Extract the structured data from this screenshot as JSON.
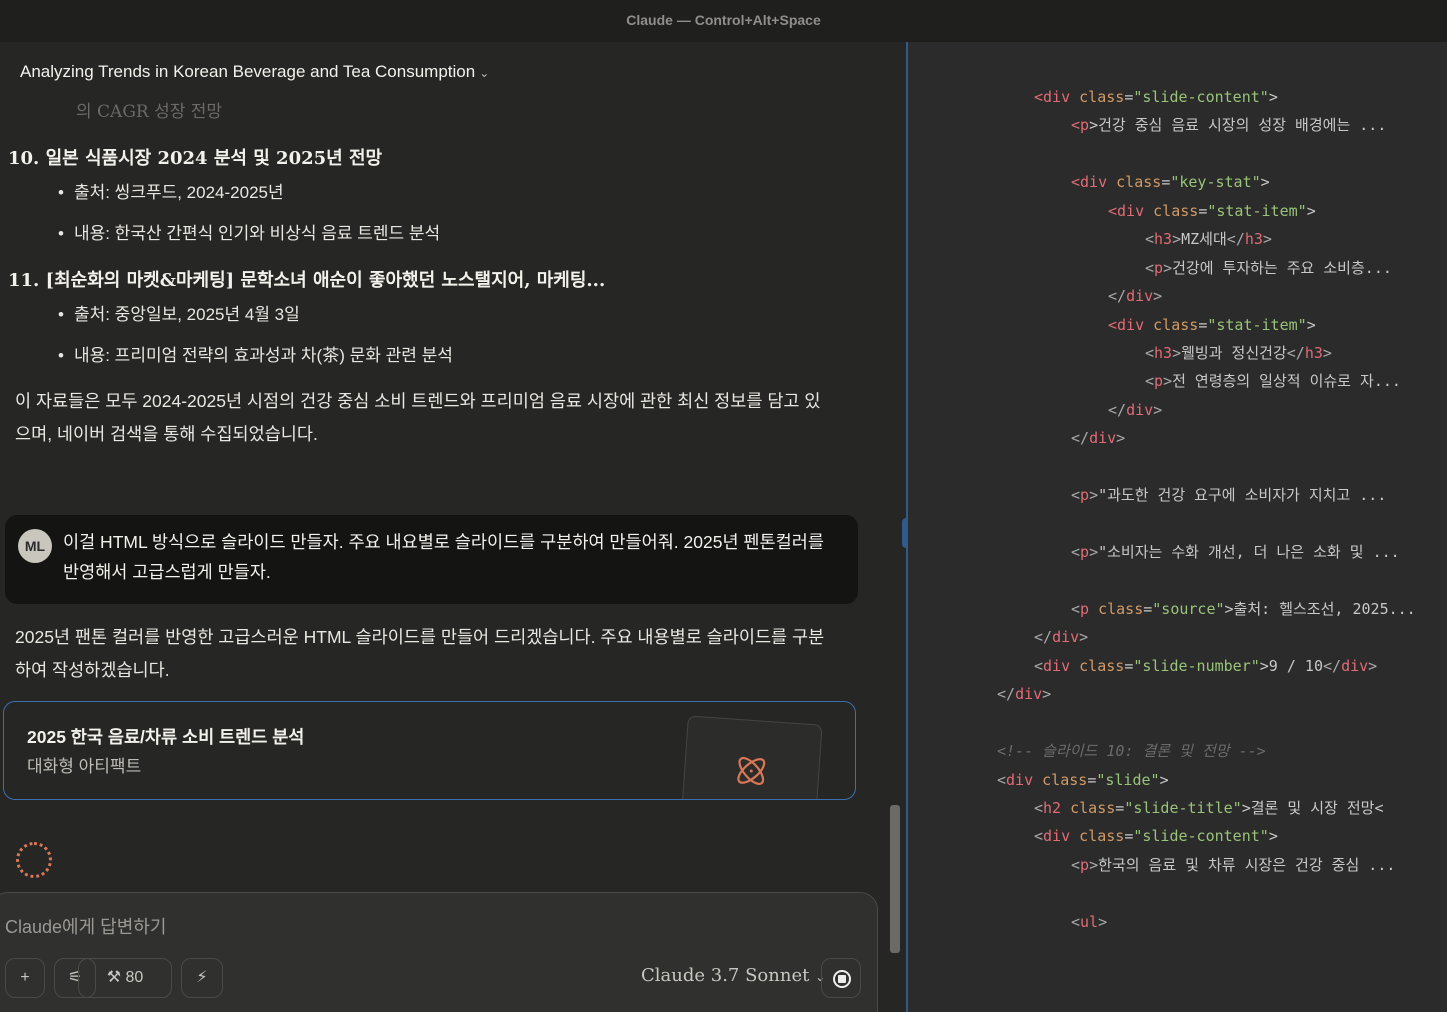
{
  "window": {
    "title": "Claude — Control+Alt+Space"
  },
  "conversation": {
    "title": "Analyzing Trends in Korean Beverage and Tea Consumption",
    "faded_line": "의 CAGR 성장 전망",
    "items": [
      {
        "heading": "10. 일본 식품시장 2024 분석 및 2025년 전망",
        "source": "출처: 씽크푸드, 2024-2025년",
        "content": "내용: 한국산 간편식 인기와 비상식 음료 트렌드 분석"
      },
      {
        "heading": "11. [최순화의 마켓&마케팅] 문학소녀 애순이 좋아했던 노스탤지어, 마케팅...",
        "source": "출처: 중앙일보, 2025년 4월 3일",
        "content": "내용: 프리미엄 전략의 효과성과 차(茶) 문화 관련 분석"
      }
    ],
    "summary": "이 자료들은 모두 2024-2025년 시점의 건강 중심 소비 트렌드와 프리미엄 음료 시장에 관한 최신 정보를 담고 있으며, 네이버 검색을 통해 수집되었습니다.",
    "user": {
      "initials": "ML",
      "message": "이걸 HTML 방식으로 슬라이드 만들자. 주요 내요별로 슬라이드를 구분하여 만들어줘. 2025년 펜톤컬러를 반영해서 고급스럽게 만들자."
    },
    "reply": "2025년 팬톤 컬러를 반영한 고급스러운 HTML 슬라이드를 만들어 드리겠습니다. 주요 내용별로 슬라이드를 구분하여 작성하겠습니다.",
    "artifact": {
      "title": "2025 한국 음료/차류 소비 트렌드 분석",
      "subtitle": "대화형 아티팩트"
    }
  },
  "composer": {
    "placeholder": "Claude에게 답변하기",
    "tools_count": "80",
    "model": "Claude 3.7 Sonnet"
  },
  "code_lines": [
    [
      1,
      [
        [
          "t",
          "<div "
        ],
        [
          "a",
          "class"
        ],
        [
          "x",
          "="
        ],
        [
          "s",
          "\"slide-content\""
        ],
        [
          "x",
          ">"
        ]
      ]
    ],
    [
      2,
      [
        [
          "t",
          "<p"
        ],
        [
          "x",
          ">건강 중심 음료 시장의 성장 배경에는 ..."
        ]
      ]
    ],
    [
      0,
      []
    ],
    [
      2,
      [
        [
          "t",
          "<div "
        ],
        [
          "a",
          "class"
        ],
        [
          "x",
          "="
        ],
        [
          "s",
          "\"key-stat\""
        ],
        [
          "x",
          ">"
        ]
      ]
    ],
    [
      3,
      [
        [
          "t",
          "<div "
        ],
        [
          "a",
          "class"
        ],
        [
          "x",
          "="
        ],
        [
          "s",
          "\"stat-item\""
        ],
        [
          "x",
          ">"
        ]
      ]
    ],
    [
      4,
      [
        [
          "g",
          "<"
        ],
        [
          "t",
          "h3"
        ],
        [
          "g",
          ">"
        ],
        [
          "x",
          "MZ세대"
        ],
        [
          "g",
          "</"
        ],
        [
          "t",
          "h3"
        ],
        [
          "g",
          ">"
        ]
      ]
    ],
    [
      4,
      [
        [
          "g",
          "<"
        ],
        [
          "t",
          "p"
        ],
        [
          "g",
          ">"
        ],
        [
          "x",
          "건강에 투자하는 주요 소비층..."
        ]
      ]
    ],
    [
      3,
      [
        [
          "g",
          "</"
        ],
        [
          "t",
          "div"
        ],
        [
          "g",
          ">"
        ]
      ]
    ],
    [
      3,
      [
        [
          "t",
          "<div "
        ],
        [
          "a",
          "class"
        ],
        [
          "x",
          "="
        ],
        [
          "s",
          "\"stat-item\""
        ],
        [
          "x",
          ">"
        ]
      ]
    ],
    [
      4,
      [
        [
          "g",
          "<"
        ],
        [
          "t",
          "h3"
        ],
        [
          "g",
          ">"
        ],
        [
          "x",
          "웰빙과 정신건강"
        ],
        [
          "g",
          "</"
        ],
        [
          "t",
          "h3"
        ],
        [
          "g",
          ">"
        ]
      ]
    ],
    [
      4,
      [
        [
          "g",
          "<"
        ],
        [
          "t",
          "p"
        ],
        [
          "g",
          ">"
        ],
        [
          "x",
          "전 연령층의 일상적 이슈로 자..."
        ]
      ]
    ],
    [
      3,
      [
        [
          "g",
          "</"
        ],
        [
          "t",
          "div"
        ],
        [
          "g",
          ">"
        ]
      ]
    ],
    [
      2,
      [
        [
          "g",
          "</"
        ],
        [
          "t",
          "div"
        ],
        [
          "g",
          ">"
        ]
      ]
    ],
    [
      0,
      []
    ],
    [
      2,
      [
        [
          "g",
          "<"
        ],
        [
          "t",
          "p"
        ],
        [
          "g",
          ">"
        ],
        [
          "x",
          "\"과도한 건강 요구에 소비자가 지치고 ..."
        ]
      ]
    ],
    [
      0,
      []
    ],
    [
      2,
      [
        [
          "g",
          "<"
        ],
        [
          "t",
          "p"
        ],
        [
          "g",
          ">"
        ],
        [
          "x",
          "\"소비자는 수화 개선, 더 나은 소화 및 ..."
        ]
      ]
    ],
    [
      0,
      []
    ],
    [
      2,
      [
        [
          "g",
          "<"
        ],
        [
          "t",
          "p "
        ],
        [
          "a",
          "class"
        ],
        [
          "x",
          "="
        ],
        [
          "s",
          "\"source\""
        ],
        [
          "x",
          ">출처: 헬스조선, 2025..."
        ]
      ]
    ],
    [
      1,
      [
        [
          "g",
          "</"
        ],
        [
          "t",
          "div"
        ],
        [
          "g",
          ">"
        ]
      ]
    ],
    [
      1,
      [
        [
          "g",
          "<"
        ],
        [
          "t",
          "div "
        ],
        [
          "a",
          "class"
        ],
        [
          "x",
          "="
        ],
        [
          "s",
          "\"slide-number\""
        ],
        [
          "x",
          ">9 / 10"
        ],
        [
          "g",
          "</"
        ],
        [
          "t",
          "div"
        ],
        [
          "g",
          ">"
        ]
      ]
    ],
    [
      0,
      [
        [
          "g",
          "</"
        ],
        [
          "t",
          "div"
        ],
        [
          "g",
          ">"
        ]
      ]
    ],
    [
      0,
      []
    ],
    [
      0,
      [
        [
          "c",
          "<!-- 슬라이드 10: 결론 및 전망 -->"
        ]
      ]
    ],
    [
      0,
      [
        [
          "g",
          "<"
        ],
        [
          "t",
          "div "
        ],
        [
          "a",
          "class"
        ],
        [
          "x",
          "="
        ],
        [
          "s",
          "\"slide\""
        ],
        [
          "x",
          ">"
        ]
      ]
    ],
    [
      1,
      [
        [
          "g",
          "<"
        ],
        [
          "t",
          "h2 "
        ],
        [
          "a",
          "class"
        ],
        [
          "x",
          "="
        ],
        [
          "s",
          "\"slide-title\""
        ],
        [
          "x",
          ">결론 및 시장 전망<"
        ]
      ]
    ],
    [
      1,
      [
        [
          "g",
          "<"
        ],
        [
          "t",
          "div "
        ],
        [
          "a",
          "class"
        ],
        [
          "x",
          "="
        ],
        [
          "s",
          "\"slide-content\""
        ],
        [
          "x",
          ">"
        ]
      ]
    ],
    [
      2,
      [
        [
          "g",
          "<"
        ],
        [
          "t",
          "p"
        ],
        [
          "g",
          ">"
        ],
        [
          "x",
          "한국의 음료 및 차류 시장은 건강 중심 ..."
        ]
      ]
    ],
    [
      0,
      []
    ],
    [
      2,
      [
        [
          "g",
          "<"
        ],
        [
          "t",
          "ul"
        ],
        [
          "g",
          ">"
        ]
      ]
    ]
  ]
}
